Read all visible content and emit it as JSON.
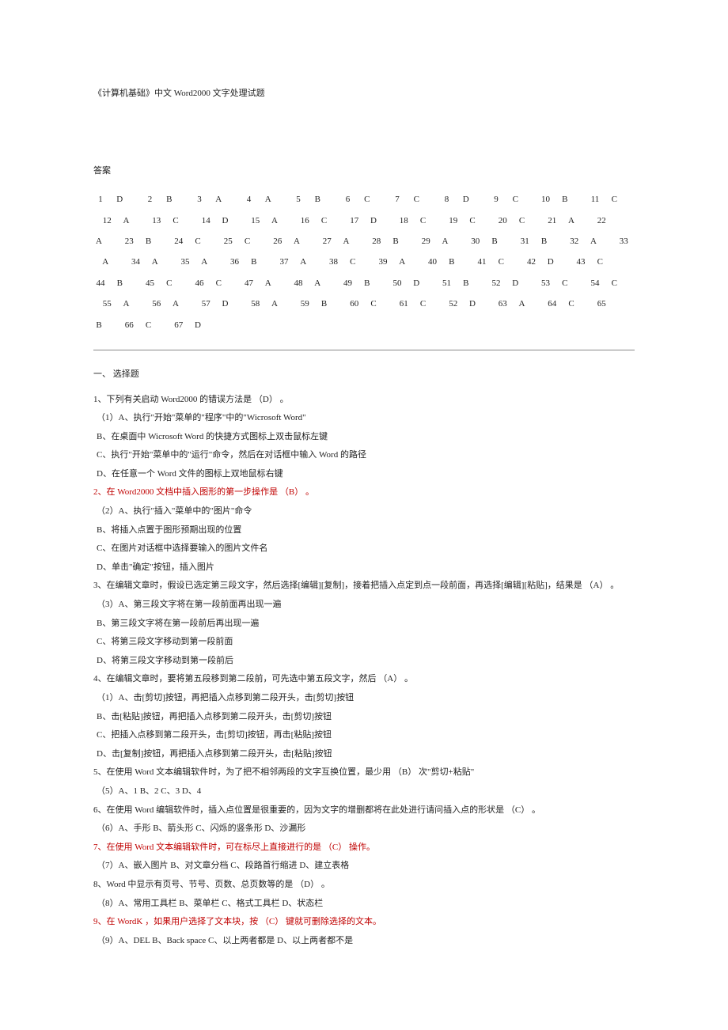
{
  "title": "《计算机基础》中文 Word2000 文字处理试题",
  "answers_label": "答案",
  "answers": [
    {
      "n": "1",
      "a": "D"
    },
    {
      "n": "2",
      "a": "B"
    },
    {
      "n": "3",
      "a": "A"
    },
    {
      "n": "4",
      "a": "A"
    },
    {
      "n": "5",
      "a": "B"
    },
    {
      "n": "6",
      "a": "C"
    },
    {
      "n": "7",
      "a": "C"
    },
    {
      "n": "8",
      "a": "D"
    },
    {
      "n": "9",
      "a": "C"
    },
    {
      "n": "10",
      "a": "B"
    },
    {
      "n": "11",
      "a": "C"
    },
    {
      "n": "12",
      "a": "A"
    },
    {
      "n": "13",
      "a": "C"
    },
    {
      "n": "14",
      "a": "D"
    },
    {
      "n": "15",
      "a": "A"
    },
    {
      "n": "16",
      "a": "C"
    },
    {
      "n": "17",
      "a": "D"
    },
    {
      "n": "18",
      "a": "C"
    },
    {
      "n": "19",
      "a": "C"
    },
    {
      "n": "20",
      "a": "C"
    },
    {
      "n": "21",
      "a": "A"
    },
    {
      "n": "22",
      "a": "A"
    },
    {
      "n": "23",
      "a": "B"
    },
    {
      "n": "24",
      "a": "C"
    },
    {
      "n": "25",
      "a": "C"
    },
    {
      "n": "26",
      "a": "A"
    },
    {
      "n": "27",
      "a": "A"
    },
    {
      "n": "28",
      "a": "B"
    },
    {
      "n": "29",
      "a": "A"
    },
    {
      "n": "30",
      "a": "B"
    },
    {
      "n": "31",
      "a": "B"
    },
    {
      "n": "32",
      "a": "A"
    },
    {
      "n": "33",
      "a": "A"
    },
    {
      "n": "34",
      "a": "A"
    },
    {
      "n": "35",
      "a": "A"
    },
    {
      "n": "36",
      "a": "B"
    },
    {
      "n": "37",
      "a": "A"
    },
    {
      "n": "38",
      "a": "C"
    },
    {
      "n": "39",
      "a": "A"
    },
    {
      "n": "40",
      "a": "B"
    },
    {
      "n": "41",
      "a": "C"
    },
    {
      "n": "42",
      "a": "D"
    },
    {
      "n": "43",
      "a": "C"
    },
    {
      "n": "44",
      "a": "B"
    },
    {
      "n": "45",
      "a": "C"
    },
    {
      "n": "46",
      "a": "C"
    },
    {
      "n": "47",
      "a": "A"
    },
    {
      "n": "48",
      "a": "A"
    },
    {
      "n": "49",
      "a": "B"
    },
    {
      "n": "50",
      "a": "D"
    },
    {
      "n": "51",
      "a": "B"
    },
    {
      "n": "52",
      "a": "D"
    },
    {
      "n": "53",
      "a": "C"
    },
    {
      "n": "54",
      "a": "C"
    },
    {
      "n": "55",
      "a": "A"
    },
    {
      "n": "56",
      "a": "A"
    },
    {
      "n": "57",
      "a": "D"
    },
    {
      "n": "58",
      "a": "A"
    },
    {
      "n": "59",
      "a": "B"
    },
    {
      "n": "60",
      "a": "C"
    },
    {
      "n": "61",
      "a": "C"
    },
    {
      "n": "52",
      "a": "D"
    },
    {
      "n": "63",
      "a": "A"
    },
    {
      "n": "64",
      "a": "C"
    },
    {
      "n": "65",
      "a": "B"
    },
    {
      "n": "66",
      "a": "C"
    },
    {
      "n": "67",
      "a": "D"
    }
  ],
  "section_heading": "一、 选择题",
  "q1": {
    "stem": "1、下列有关启动 Word2000 的错误方法是   （D） 。",
    "a": "（1）A、执行\"开始\"菜单的\"程序\"中的\"Wicrosoft Word\"",
    "b": "      B、在桌面中 Wicrosoft Word 的快捷方式图标上双击鼠标左键",
    "c": "      C、执行\"开始\"菜单中的\"运行\"命令，然后在对话框中输入 Word 的路径",
    "d": "      D、在任意一个 Word 文件的图标上双地鼠标右键"
  },
  "q2": {
    "stem": "2、在 Word2000 文档中插入图形的第一步操作是   （B） 。",
    "a": "（2）A、执行\"插入\"菜单中的\"图片\"命令",
    "b": "      B、将插入点置于图形预期出现的位置",
    "c": "      C、在图片对话框中选择要输入的图片文件名",
    "d": "      D、单击\"确定\"按钮，插入图片"
  },
  "q3": {
    "stem": "3、在编辑文章时，假设已选定第三段文字，然后选择[编辑][复制]，接着把插入点定到点一段前面，再选择[编辑][粘贴]，结果是   （A） 。",
    "a": "（3）A、第三段文字将在第一段前面再出现一遍",
    "b": "      B、第三段文字将在第一段前后再出现一遍",
    "c": "      C、将第三段文字移动到第一段前面",
    "d": "      D、将第三段文字移动到第一段前后"
  },
  "q4": {
    "stem": "4、在编辑文章时，要将第五段移到第二段前，可先选中第五段文字，然后   （A） 。",
    "a": "（1）A、击[剪切]按钮，再把插入点移到第二段开头，击[剪切]按钮",
    "b": "      B、击[粘贴]按钮，再把插入点移到第二段开头，击[剪切]按钮",
    "c": "      C、把插入点移到第二段开头，击[剪切]按钮，再击[粘贴]按钮",
    "d": "      D、击[复制]按钮，再把插入点移到第二段开头，击[粘贴]按钮"
  },
  "q5": {
    "stem": "5、在使用 Word 文本编辑软件时，为了把不相邻两段的文字互换位置，最少用   （B） 次\"剪切+粘贴\"",
    "opts": "（5）A、1                B、2                C、3            D、4"
  },
  "q6": {
    "stem": "6、在使用 Word 编辑软件时，插入点位置是很重要的，因为文字的增删都将在此处进行请问插入点的形状是   （C） 。",
    "opts": "（6）A、手形              B、箭头形            C、闪烁的竖条形          D、沙漏形"
  },
  "q7": {
    "stem": "7、在使用 Word 文本编辑软件时，可在标尽上直接进行的是   （C） 操作。",
    "opts": "（7）A、嵌入图片          B、对文章分档       C、段路首行缩进    D、建立表格"
  },
  "q8": {
    "stem": "8、Word 中显示有页号、节号、页数、总页数等的是   （D） 。",
    "opts": "（8）A、常用工具栏    B、菜单栏        C、格式工具栏     D、状态栏"
  },
  "q9": {
    "stem": "9、在 WordK ，如果用户选择了文本块，按   （C） 键就可删除选择的文本。",
    "opts": "（9）A、DEL              B、Back space        C、以上两者都是   D、以上两者都不是"
  }
}
